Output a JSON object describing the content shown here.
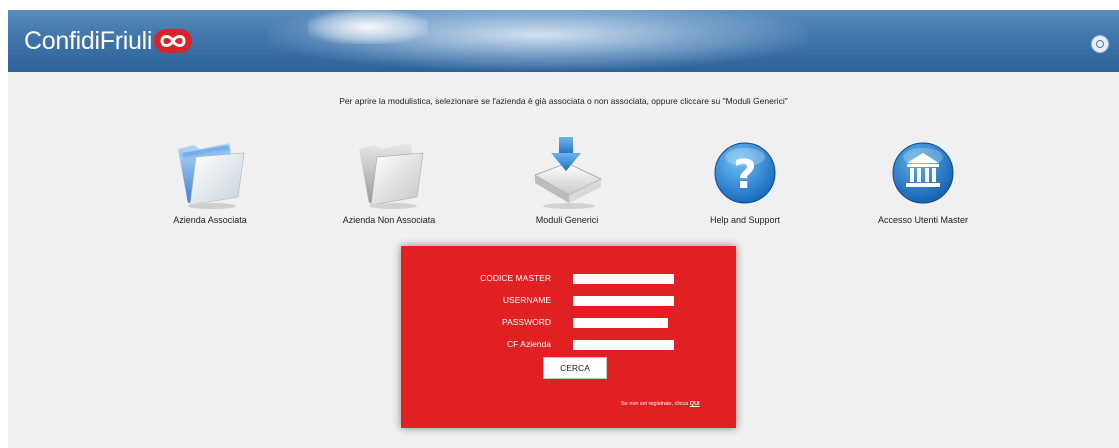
{
  "header": {
    "brand_text": "ConfidiFriuli",
    "power_icon": "power-icon"
  },
  "instruction": "Per aprire la modulistica, selezionare se l'azienda è già associata o non associata, oppure cliccare su \"Moduli Generici\"",
  "tiles": [
    {
      "label": "Azienda Associata",
      "icon": "blue-folder-icon"
    },
    {
      "label": "Azienda Non Associata",
      "icon": "gray-folder-icon"
    },
    {
      "label": "Moduli Generici",
      "icon": "download-drive-icon"
    },
    {
      "label": "Help and Support",
      "icon": "question-mark-icon"
    },
    {
      "label": "Accesso Utenti Master",
      "icon": "bank-building-icon"
    }
  ],
  "login": {
    "fields": [
      {
        "label": "CODICE MASTER",
        "value": ""
      },
      {
        "label": "USERNAME",
        "value": ""
      },
      {
        "label": "PASSWORD",
        "value": ""
      },
      {
        "label": "CF Azienda",
        "value": ""
      }
    ],
    "submit_label": "CERCA",
    "register_text": "Se non sei registrato, clicca",
    "register_link": "QUI"
  },
  "colors": {
    "header_blue": "#3f75aa",
    "login_red": "#e02023",
    "background": "#f0f0f0"
  }
}
